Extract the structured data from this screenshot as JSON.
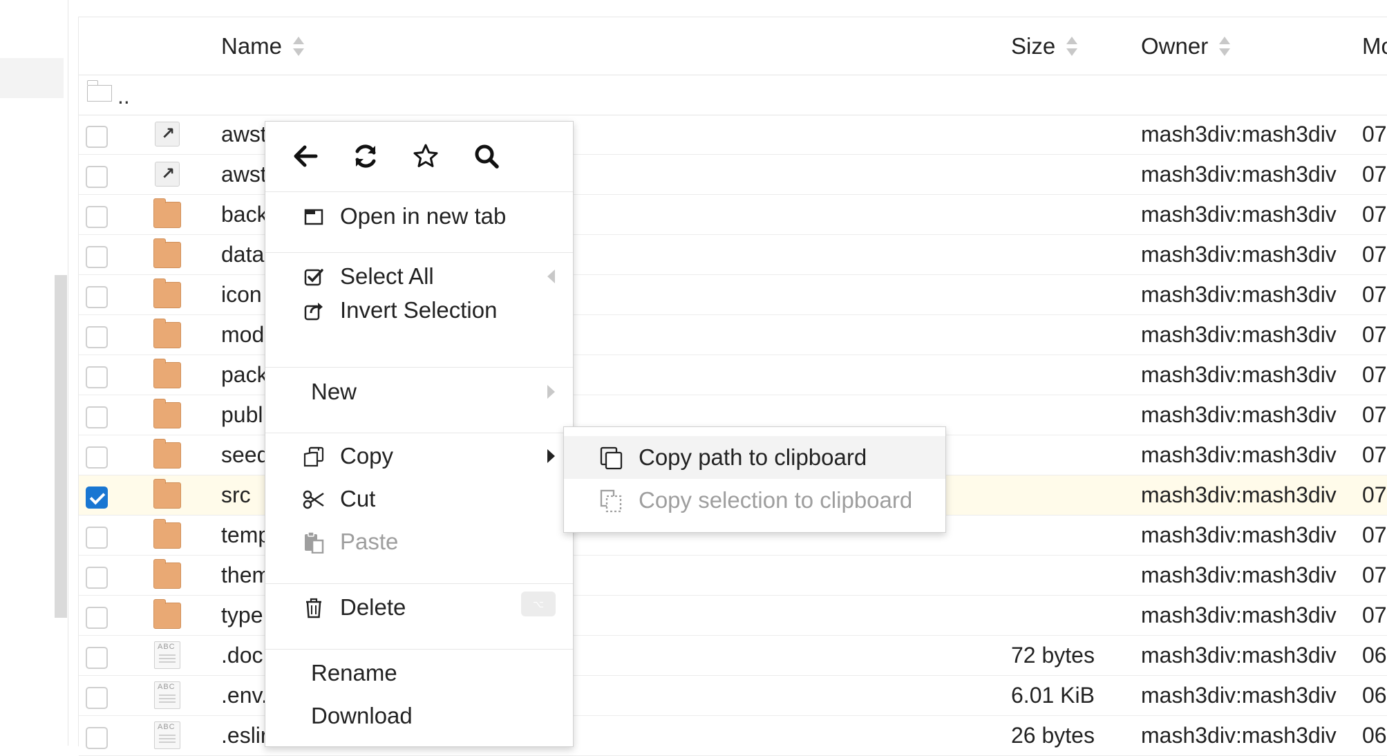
{
  "table": {
    "columns": {
      "name": "Name",
      "size": "Size",
      "owner": "Owner",
      "modified": "Mo"
    },
    "parent_label": "..",
    "rows": [
      {
        "name": "awst",
        "type": "link",
        "size": "",
        "owner": "mash3div:mash3div",
        "modified": "07",
        "checked": false
      },
      {
        "name": "awst",
        "type": "link",
        "size": "",
        "owner": "mash3div:mash3div",
        "modified": "07",
        "checked": false
      },
      {
        "name": "back",
        "type": "folder",
        "size": "",
        "owner": "mash3div:mash3div",
        "modified": "07",
        "checked": false
      },
      {
        "name": "data",
        "type": "folder",
        "size": "",
        "owner": "mash3div:mash3div",
        "modified": "07",
        "checked": false
      },
      {
        "name": "icon",
        "type": "folder",
        "size": "",
        "owner": "mash3div:mash3div",
        "modified": "07",
        "checked": false
      },
      {
        "name": "mod",
        "type": "folder",
        "size": "",
        "owner": "mash3div:mash3div",
        "modified": "07",
        "checked": false
      },
      {
        "name": "pack",
        "type": "folder",
        "size": "",
        "owner": "mash3div:mash3div",
        "modified": "07",
        "checked": false
      },
      {
        "name": "publ",
        "type": "folder",
        "size": "",
        "owner": "mash3div:mash3div",
        "modified": "07",
        "checked": false
      },
      {
        "name": "seed",
        "type": "folder",
        "size": "",
        "owner": "mash3div:mash3div",
        "modified": "07",
        "checked": false
      },
      {
        "name": "src",
        "type": "folder",
        "size": "",
        "owner": "mash3div:mash3div",
        "modified": "07",
        "checked": true
      },
      {
        "name": "temp",
        "type": "folder",
        "size": "",
        "owner": "mash3div:mash3div",
        "modified": "07",
        "checked": false
      },
      {
        "name": "them",
        "type": "folder",
        "size": "",
        "owner": "mash3div:mash3div",
        "modified": "07",
        "checked": false
      },
      {
        "name": "type",
        "type": "folder",
        "size": "",
        "owner": "mash3div:mash3div",
        "modified": "07",
        "checked": false
      },
      {
        "name": ".doc",
        "type": "text",
        "size": "72 bytes",
        "owner": "mash3div:mash3div",
        "modified": "06",
        "checked": false
      },
      {
        "name": ".env.",
        "type": "text",
        "size": "6.01 KiB",
        "owner": "mash3div:mash3div",
        "modified": "06",
        "checked": false
      },
      {
        "name": ".eslir",
        "type": "text",
        "size": "26 bytes",
        "owner": "mash3div:mash3div",
        "modified": "06",
        "checked": false
      }
    ]
  },
  "context_menu": {
    "toolbar_icons": [
      "back-arrow-icon",
      "refresh-icon",
      "star-icon",
      "search-icon"
    ],
    "open_new_tab": "Open in new tab",
    "select_all": "Select All",
    "invert_selection": "Invert Selection",
    "new": "New",
    "copy": "Copy",
    "cut": "Cut",
    "paste": "Paste",
    "delete": "Delete",
    "delete_shortcut": "⌥",
    "rename": "Rename",
    "download": "Download"
  },
  "copy_submenu": {
    "copy_path": "Copy path to clipboard",
    "copy_selection": "Copy selection to clipboard"
  },
  "colors": {
    "folder": "#e9a974",
    "checkbox_checked": "#1976d2",
    "selected_row": "#fffbea",
    "disabled_text": "#9e9e9e"
  }
}
